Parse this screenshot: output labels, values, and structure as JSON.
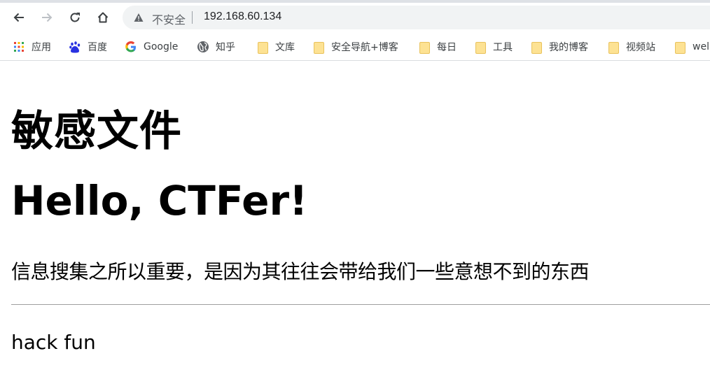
{
  "browser": {
    "security_label": "不安全",
    "url": "192.168.60.134",
    "bookmarks": [
      {
        "label": "应用",
        "icon": "apps-grid-icon"
      },
      {
        "label": "百度",
        "icon": "baidu-paw-icon"
      },
      {
        "label": "Google",
        "icon": "google-g-icon"
      },
      {
        "label": "知乎",
        "icon": "globe-icon"
      },
      {
        "label": "文库",
        "icon": "folder-icon"
      },
      {
        "label": "安全导航+博客",
        "icon": "folder-icon"
      },
      {
        "label": "每日",
        "icon": "folder-icon"
      },
      {
        "label": "工具",
        "icon": "folder-icon"
      },
      {
        "label": "我的博客",
        "icon": "folder-icon"
      },
      {
        "label": "视频站",
        "icon": "folder-icon"
      },
      {
        "label": "wel",
        "icon": "folder-icon"
      }
    ]
  },
  "page": {
    "title": "敏感文件",
    "heading": "Hello, CTFer!",
    "description": "信息搜集之所以重要，是因为其往往会带给我们一些意想不到的东西",
    "footer_text": "hack fun"
  },
  "colors": {
    "folder_fill": "#fde293",
    "omnibox_bg": "#f1f3f4",
    "text_gray": "#5f6368"
  }
}
